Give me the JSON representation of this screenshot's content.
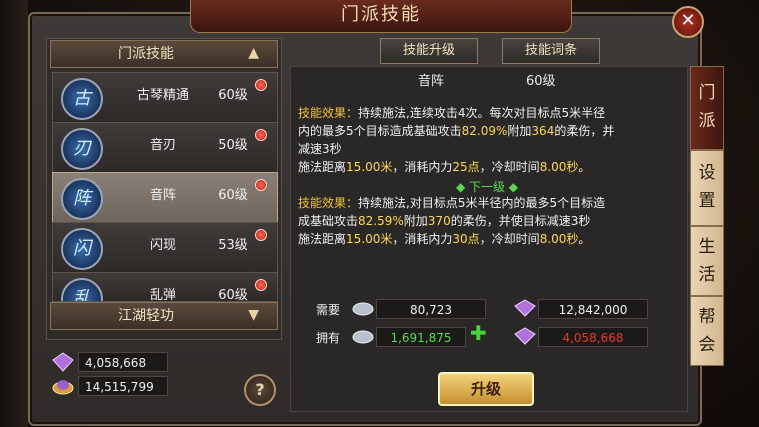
{
  "window": {
    "title": "门派技能",
    "close_label": "✕"
  },
  "left": {
    "header": "门派技能",
    "skills": [
      {
        "icon": "古",
        "name": "古琴精通",
        "level": "60级"
      },
      {
        "icon": "刃",
        "name": "音刃",
        "level": "50级"
      },
      {
        "icon": "阵",
        "name": "音阵",
        "level": "60级"
      },
      {
        "icon": "闪",
        "name": "闪现",
        "level": "53级"
      },
      {
        "icon": "乱",
        "name": "乱弹",
        "level": "60级"
      }
    ],
    "section2": "江湖轻功",
    "resources": [
      "4,058,668",
      "14,515,799"
    ],
    "help": "?"
  },
  "tabs": {
    "upgrade": "技能升级",
    "affix": "技能词条"
  },
  "info": {
    "skill_name": "音阵",
    "skill_level": "60级",
    "current_label": "技能效果：",
    "current_line1": "持续施法,连续攻击4次。每次对目标点5米半径",
    "current_line2a": "内的最多5个目标造成基础攻击",
    "current_pct": "82.09%",
    "current_line2b": "附加",
    "current_dmg": "364",
    "current_line2c": "的柔伤，并",
    "current_line3": "减速3秒",
    "current_range_a": "施法距离",
    "current_range": "15.00米",
    "current_range_b": "，消耗内力",
    "current_cost": "25点",
    "current_range_c": "，冷却时间",
    "current_cd": "8.00秒",
    "current_range_d": "。",
    "next_label": "◆ 下一级 ◆",
    "next_effect_label": "技能效果：",
    "next_line1": "持续施法,对目标点5米半径内的最多5个目标造",
    "next_line2a": "成基础攻击",
    "next_pct": "82.59%",
    "next_line2b": "附加",
    "next_dmg": "370",
    "next_line2c": "的柔伤，并使目标减速3秒",
    "next_range_a": "施法距离",
    "next_range": "15.00米",
    "next_range_b": "，消耗内力",
    "next_cost": "30点",
    "next_range_c": "，冷却时间",
    "next_cd": "8.00秒",
    "next_range_d": "。"
  },
  "cost": {
    "need_label": "需要",
    "have_label": "拥有",
    "need_silver": "80,723",
    "need_gem": "12,842,000",
    "have_silver": "1,691,875",
    "have_gem": "4,058,668",
    "plus": "✚"
  },
  "upgrade_button": "升级",
  "side_tabs": [
    [
      "门",
      "派"
    ],
    [
      "设",
      "置"
    ],
    [
      "生",
      "活"
    ],
    [
      "帮",
      "会"
    ]
  ],
  "colors": {
    "accent_gold": "#f2c23a",
    "green": "#58d84c",
    "red": "#e03a2a"
  }
}
